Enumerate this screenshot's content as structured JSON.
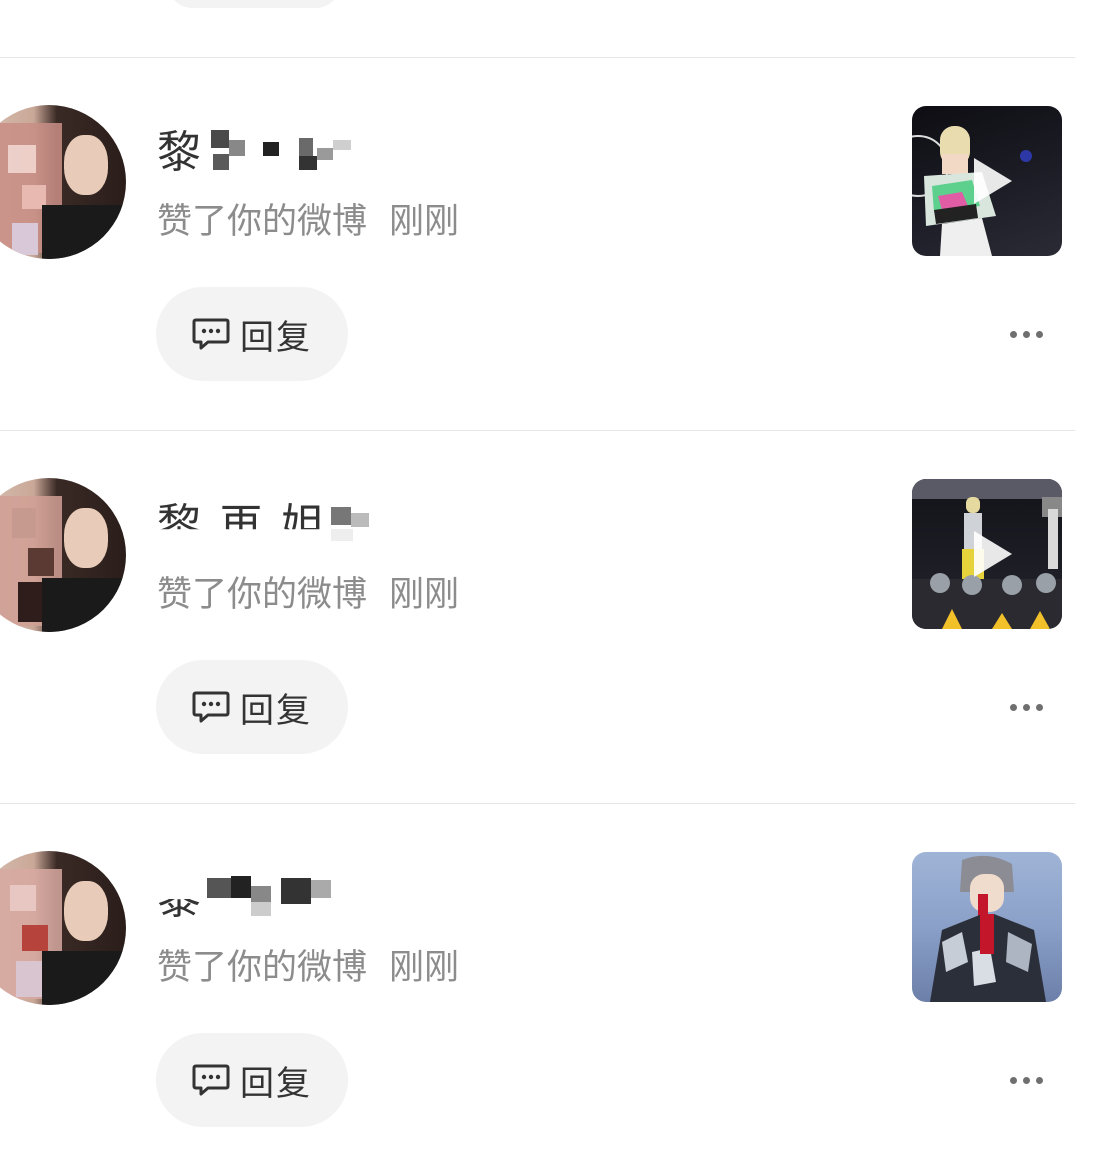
{
  "notifications": [
    {
      "name_visible": "黎",
      "action": "赞了你的微博",
      "time": "刚刚",
      "reply_label": "回复",
      "thumbnail": "video",
      "thumb_colors": [
        "#0d0d12",
        "#2b2b35"
      ]
    },
    {
      "name_visible": "黎 再 姐",
      "action": "赞了你的微博",
      "time": "刚刚",
      "reply_label": "回复",
      "thumbnail": "video",
      "thumb_colors": [
        "#121218",
        "#3a3a46"
      ]
    },
    {
      "name_visible": "黎",
      "action": "赞了你的微博",
      "time": "刚刚",
      "reply_label": "回复",
      "thumbnail": "image",
      "thumb_colors": [
        "#9fb4d6",
        "#6c7fa8"
      ]
    }
  ],
  "icons": {
    "reply": "comment-bubble-icon",
    "more": "more-dots-icon",
    "play": "play-icon"
  },
  "colors": {
    "text_primary": "#333333",
    "text_secondary": "#8c8c8c",
    "pill_bg": "#f3f3f3",
    "divider": "#e6e6e6"
  }
}
